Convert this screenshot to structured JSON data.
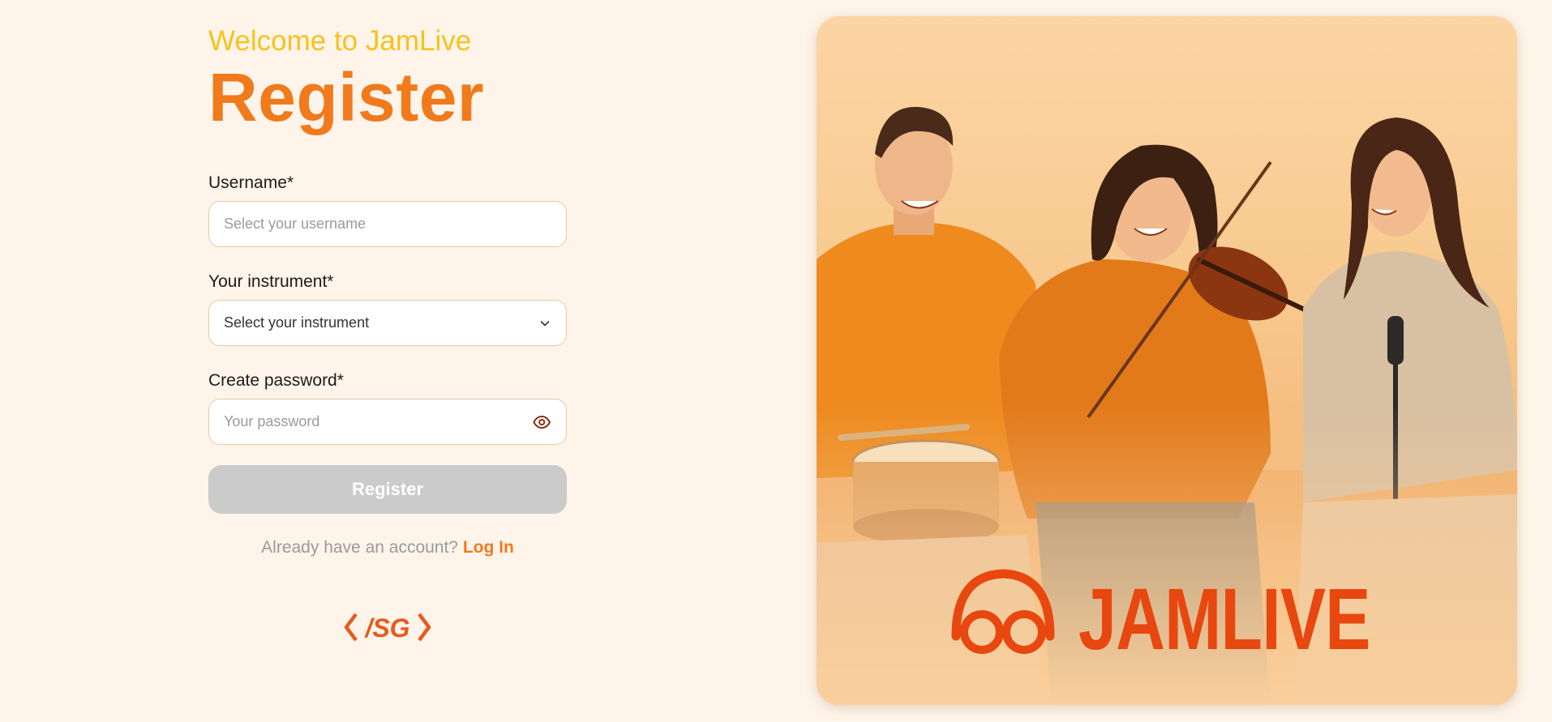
{
  "header": {
    "welcome": "Welcome to JamLive",
    "title": "Register"
  },
  "form": {
    "username": {
      "label": "Username*",
      "placeholder": "Select your username",
      "value": ""
    },
    "instrument": {
      "label": "Your instrument*",
      "selected": "Select your instrument"
    },
    "password": {
      "label": "Create password*",
      "placeholder": "Your password",
      "value": ""
    },
    "submit_label": "Register",
    "submit_enabled": false
  },
  "login": {
    "prompt": "Already have an account?",
    "link_label": "Log In"
  },
  "footer_logo": {
    "text": "</SG>",
    "icon": "sg-logo"
  },
  "hero": {
    "brand": "JAMLIVE",
    "logo_icon": "headphones-logo-icon",
    "image_description_icon": "band-photo"
  },
  "colors": {
    "background": "#fef4ea",
    "accent_orange": "#f07a1c",
    "welcome_yellow": "#f6c21c",
    "brand_red": "#e8470f",
    "disabled_button": "#cbcbcb"
  }
}
